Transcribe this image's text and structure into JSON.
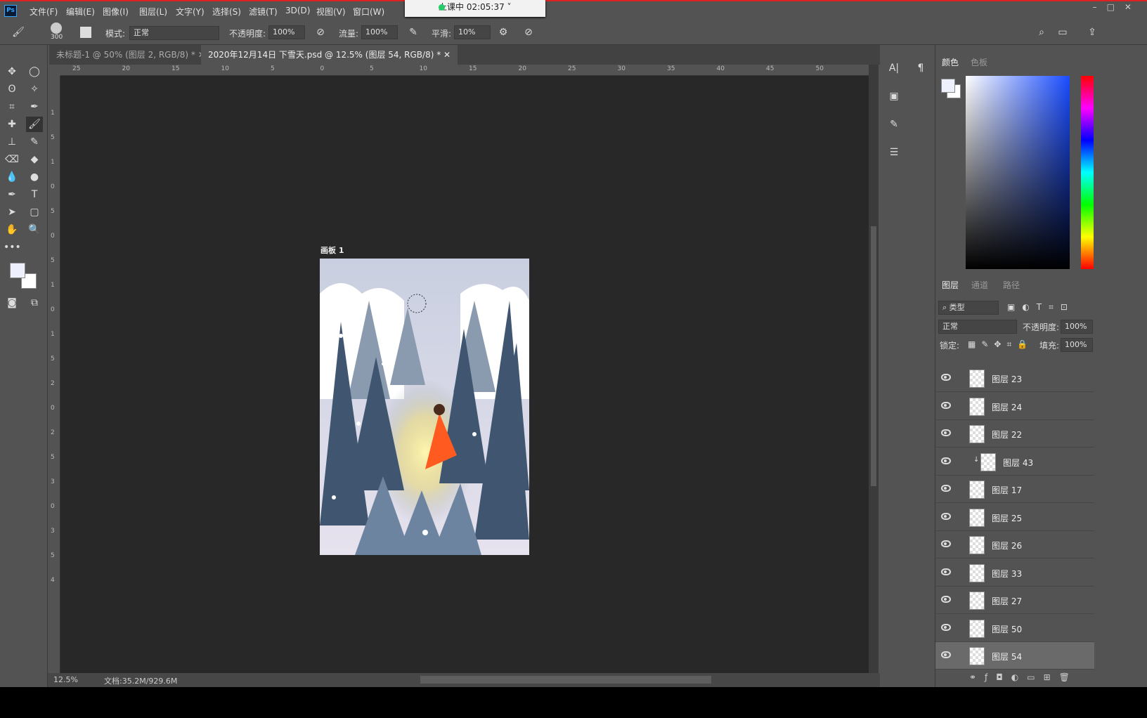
{
  "app": {
    "logo": "Ps"
  },
  "menu": [
    "文件(F)",
    "编辑(E)",
    "图像(I)",
    "图层(L)",
    "文字(Y)",
    "选择(S)",
    "滤镜(T)",
    "3D(D)",
    "视图(V)",
    "窗口(W)"
  ],
  "timer": {
    "text": "上课中 02:05:37",
    "status_color": "#22cc66"
  },
  "options": {
    "brush_size": "300",
    "mode_label": "模式:",
    "mode_value": "正常",
    "opacity_label": "不透明度:",
    "opacity_value": "100%",
    "flow_label": "流量:",
    "flow_value": "100%",
    "smooth_label": "平滑:",
    "smooth_value": "10%"
  },
  "tabs": [
    {
      "label": "未标题-1 @ 50% (图层 2, RGB/8) *",
      "active": false
    },
    {
      "label": "2020年12月14日 下雪天.psd @ 12.5% (图层 54, RGB/8) *",
      "active": true
    }
  ],
  "ruler_top": [
    "25",
    "20",
    "15",
    "10",
    "5",
    "0",
    "5",
    "10",
    "15",
    "20",
    "25",
    "30",
    "35",
    "40",
    "45",
    "50"
  ],
  "ruler_left": [
    "1",
    "5",
    "1",
    "0",
    "5",
    "0",
    "5",
    "1",
    "0",
    "1",
    "5",
    "2",
    "0",
    "2",
    "5",
    "3",
    "0",
    "3",
    "5",
    "4"
  ],
  "artboard": {
    "label": "画板 1"
  },
  "status": {
    "zoom": "12.5%",
    "doc": "文档:35.2M/929.6M"
  },
  "color_panel": {
    "tabs": [
      "颜色",
      "色板"
    ],
    "foreground": "#eef0fb",
    "background": "#ffffff",
    "hue_color": "#1a4cff"
  },
  "layers_panel": {
    "tabs": [
      "图层",
      "通道",
      "路径"
    ],
    "filter": "类型",
    "blend": "正常",
    "opacity_label": "不透明度:",
    "opacity": "100%",
    "lock_label": "锁定:",
    "fill_label": "填充:",
    "fill": "100%",
    "layers": [
      {
        "name": "图层 23",
        "clipped": false,
        "selected": false
      },
      {
        "name": "图层 24",
        "clipped": false,
        "selected": false
      },
      {
        "name": "图层 22",
        "clipped": false,
        "selected": false
      },
      {
        "name": "图层 43",
        "clipped": true,
        "selected": false
      },
      {
        "name": "图层 17",
        "clipped": false,
        "selected": false
      },
      {
        "name": "图层 25",
        "clipped": false,
        "selected": false
      },
      {
        "name": "图层 26",
        "clipped": false,
        "selected": false
      },
      {
        "name": "图层 33",
        "clipped": false,
        "selected": false
      },
      {
        "name": "图层 27",
        "clipped": false,
        "selected": false
      },
      {
        "name": "图层 50",
        "clipped": false,
        "selected": false
      },
      {
        "name": "图层 54",
        "clipped": false,
        "selected": true
      }
    ]
  }
}
